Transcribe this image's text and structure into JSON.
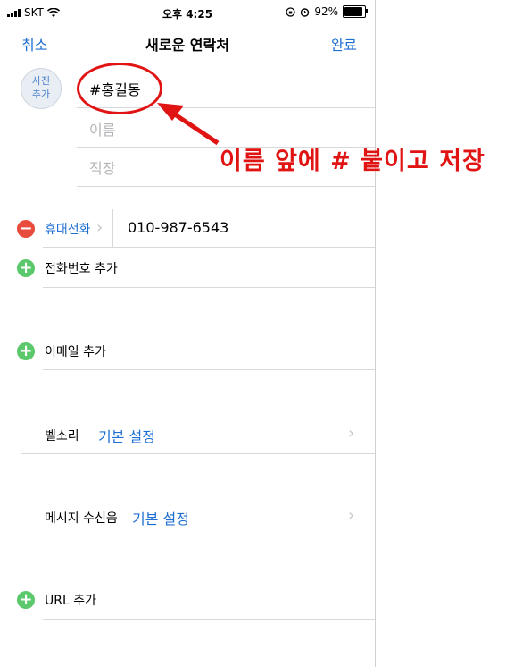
{
  "status_bar": {
    "carrier": "SKT",
    "time": "오후 4:25",
    "battery": "92%",
    "battery_level": 0.92
  },
  "nav": {
    "cancel": "취소",
    "title": "새로운 연락처",
    "done": "완료"
  },
  "photo": {
    "label_line1": "사진",
    "label_line2": "추가"
  },
  "name_fields": {
    "name_value": "#홍길동",
    "name_placeholder": "이름",
    "company_placeholder": "직장"
  },
  "phone": {
    "label": "휴대전화",
    "number": "010-987-6543"
  },
  "rows": {
    "add_phone": "전화번호 추가",
    "add_email": "이메일 추가",
    "ringtone_label": "벨소리",
    "ringtone_value": "기본 설정",
    "text_tone_label": "메시지 수신음",
    "text_tone_value": "기본 설정",
    "add_url": "URL 추가"
  },
  "annotation": {
    "text": "이름 앞에 # 붙이고 저장",
    "color": "#e11414"
  },
  "colors": {
    "accent": "#1f6fd3",
    "delete": "#e74c3c",
    "add": "#5bc96b"
  }
}
